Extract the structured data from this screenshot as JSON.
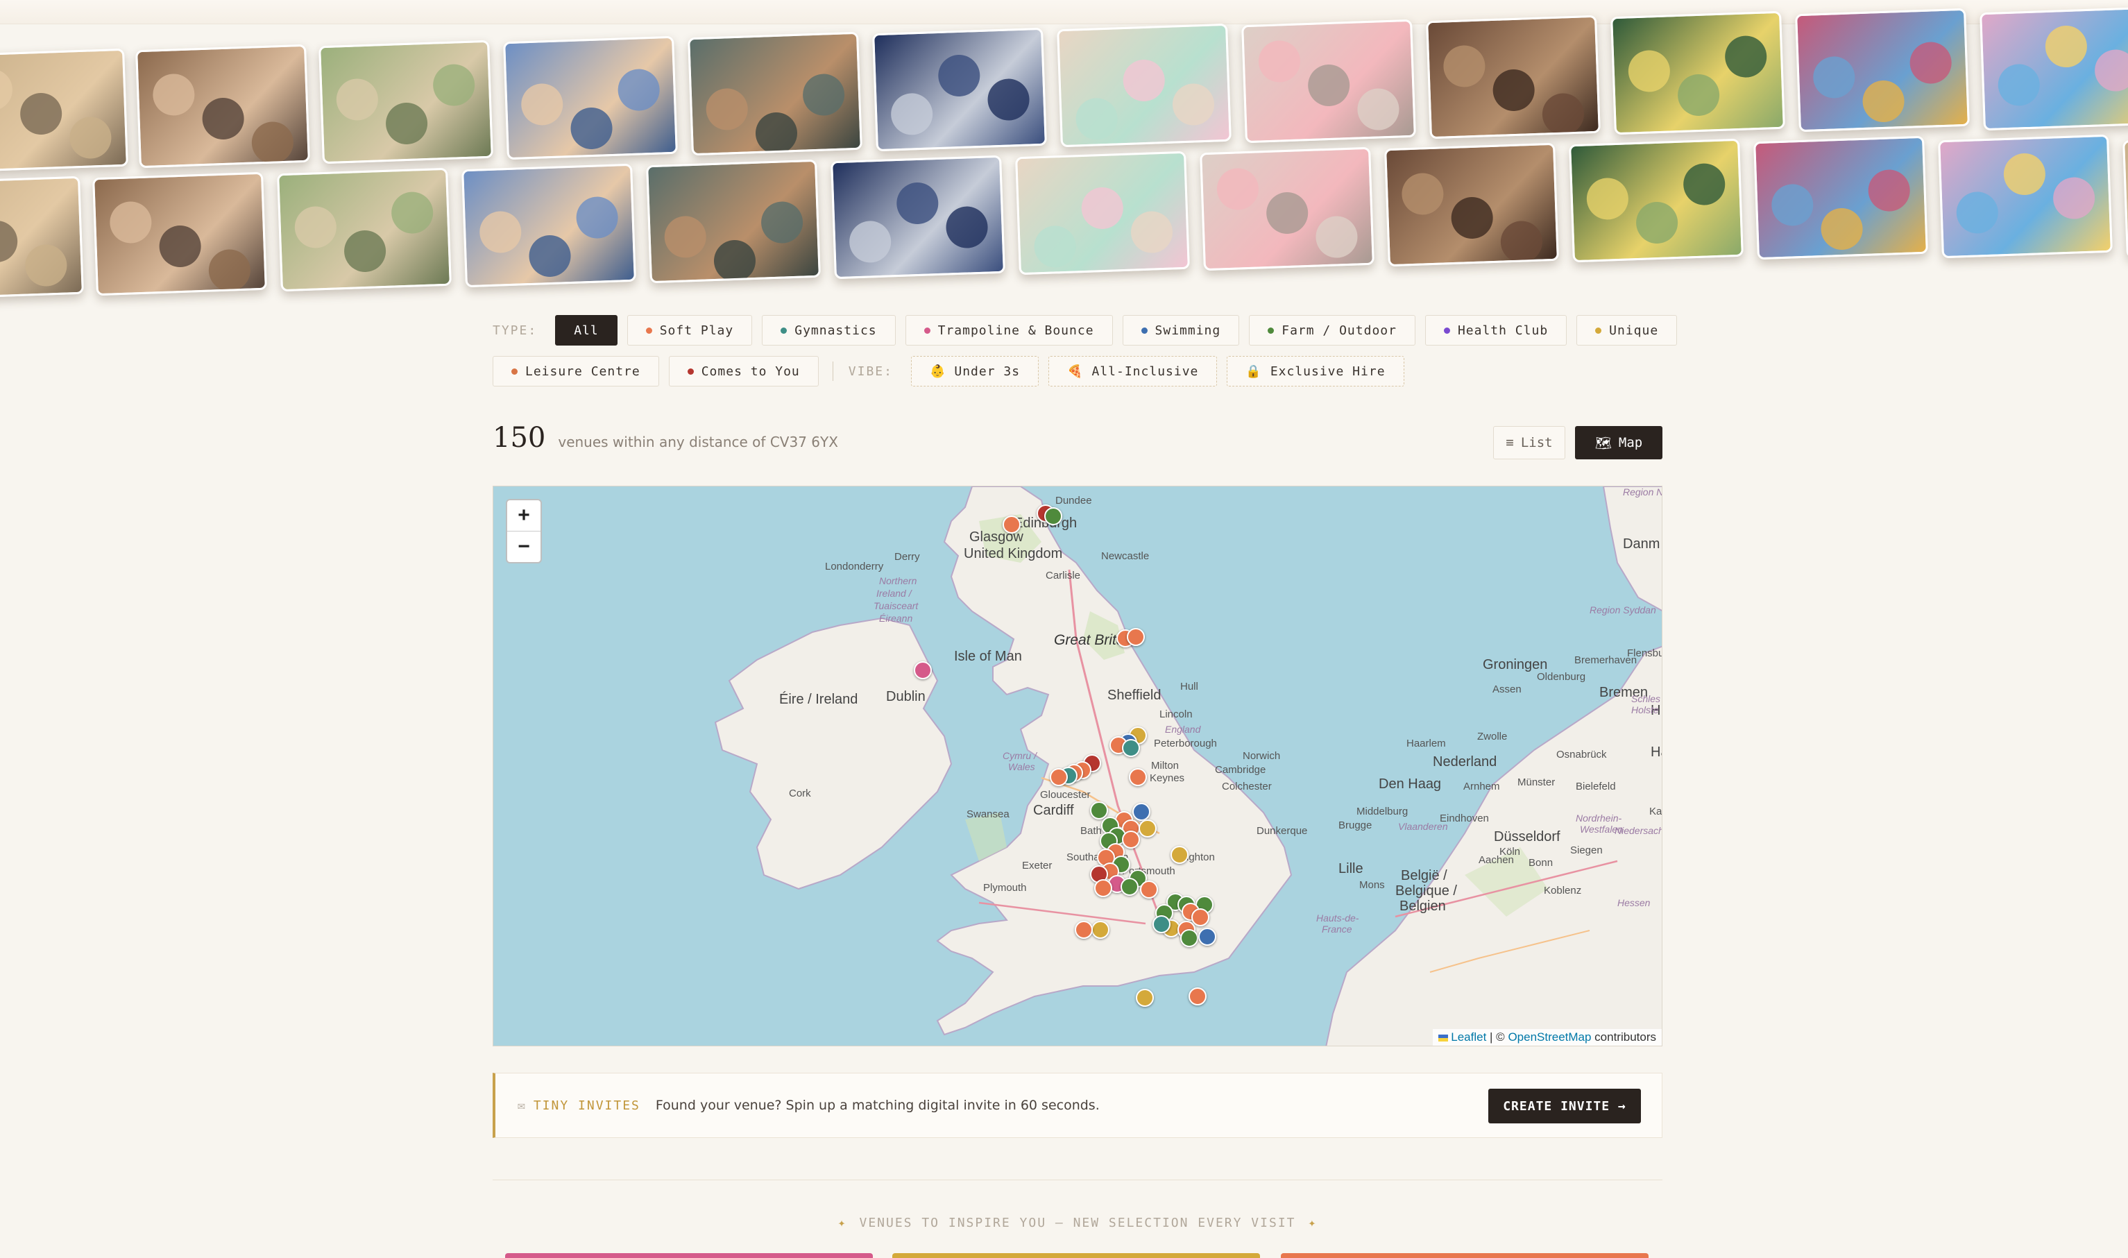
{
  "filters": {
    "type_label": "TYPE:",
    "vibe_label": "VIBE:",
    "types": [
      {
        "label": "All",
        "color": "",
        "active": true
      },
      {
        "label": "Soft Play",
        "color": "#e8774d"
      },
      {
        "label": "Gymnastics",
        "color": "#3e8e86"
      },
      {
        "label": "Trampoline & Bounce",
        "color": "#d55a8a"
      },
      {
        "label": "Swimming",
        "color": "#3e6fb0"
      },
      {
        "label": "Farm / Outdoor",
        "color": "#4f8a3c"
      },
      {
        "label": "Health Club",
        "color": "#7a4ad0"
      },
      {
        "label": "Unique",
        "color": "#d4a93a"
      },
      {
        "label": "Leisure Centre",
        "color": "#d87545"
      },
      {
        "label": "Comes to You",
        "color": "#b5362f"
      }
    ],
    "vibes": [
      {
        "label": "Under 3s",
        "icon": "baby-face-icon",
        "glyph": "👶"
      },
      {
        "label": "All-Inclusive",
        "icon": "pizza-icon",
        "glyph": "🍕"
      },
      {
        "label": "Exclusive Hire",
        "icon": "lock-icon",
        "glyph": "🔒"
      }
    ]
  },
  "results": {
    "count": "150",
    "summary": "venues within any distance of CV37 6YX",
    "list_label": "List",
    "map_label": "Map",
    "list_icon": "≡",
    "map_icon": "🗺"
  },
  "map": {
    "zoom_in": "+",
    "zoom_out": "−",
    "attribution_leaflet": "Leaflet",
    "attribution_sep": " | © ",
    "attribution_osm": "OpenStreetMap",
    "attribution_tail": " contributors",
    "labels": {
      "dundee": "Dundee",
      "edinburgh": "Edinburgh",
      "glasgow": "Glasgow",
      "uk": "United Kingdom",
      "derry": "Derry",
      "londonderry": "Londonderry",
      "ni1": "Northern",
      "ni2": "Ireland /",
      "ni3": "Tuaisceart",
      "ni4": "Éireann",
      "carlisle": "Carlisle",
      "newcastle": "Newcastle",
      "gb": "Great Britain",
      "isle_of_man": "Isle of Man",
      "ireland": "Éire / Ireland",
      "dublin": "Dublin",
      "cork": "Cork",
      "sheffield": "Sheffield",
      "hull": "Hull",
      "lincoln": "Lincoln",
      "england": "England",
      "peterborough": "Peterborough",
      "norwich": "Norwich",
      "cymru": "Cymru /",
      "wales": "Wales",
      "cambridge": "Cambridge",
      "colchester": "Colchester",
      "milton": "Milton",
      "keynes": "Keynes",
      "gloucester": "Gloucester",
      "swansea": "Swansea",
      "cardiff": "Cardiff",
      "bath": "Bath",
      "southampton": "Southampton",
      "portsmouth": "Portsmouth",
      "brighton": "Brighton",
      "exeter": "Exeter",
      "plymouth": "Plymouth",
      "dunkerque": "Dunkerque",
      "brugge": "Brugge",
      "lille": "Lille",
      "mons": "Mons",
      "belgie1": "België /",
      "belgie2": "Belgique /",
      "belgie3": "Belgien",
      "denhaag": "Den Haag",
      "nederland": "Nederland",
      "haarlem": "Haarlem",
      "groningen": "Groningen",
      "assen": "Assen",
      "zwolle": "Zwolle",
      "arnhem": "Arnhem",
      "munster": "Münster",
      "bielefeld": "Bielefeld",
      "osnabruck": "Osnabrück",
      "oldenburg": "Oldenburg",
      "bremen": "Bremen",
      "bremerhaven": "Bremerhaven",
      "dusseldorf": "Düsseldorf",
      "koln": "Köln",
      "bonn": "Bonn",
      "siegen": "Siegen",
      "koblenz": "Koblenz",
      "aachen": "Aachen",
      "eindhoven": "Eindhoven",
      "middelburg": "Middelburg",
      "danmark": "Danm",
      "flensburg": "Flensbu",
      "nrw": "Nordrhein-",
      "westfalen": "Westfalen",
      "hamburg_h": "H",
      "hannover": "Han",
      "kassel": "Kass",
      "vlaanderen": "Vlaanderen",
      "hauts": "Hauts-de-",
      "france": "France",
      "schleswig": "Schles",
      "holstein": "Holste",
      "syddanmark": "Region Syddan",
      "regionN": "Region N",
      "niedersachsen": "Niedersachsen",
      "hessen": "Hessen"
    }
  },
  "invite": {
    "icon": "envelope-icon",
    "glyph": "✉",
    "tag": "TINY INVITES",
    "message": "Found your venue? Spin up a matching digital invite in 60 seconds.",
    "cta": "CREATE INVITE →"
  },
  "inspire": {
    "text": "VENUES TO INSPIRE YOU — NEW SELECTION EVERY VISIT",
    "spark": "✦"
  },
  "colors": {
    "accent_gold": "#c8a14c",
    "dark": "#2a231f",
    "pin_soft_play": "#e8774d",
    "pin_gymnastics": "#3e8e86",
    "pin_trampoline": "#d55a8a",
    "pin_swimming": "#3e6fb0",
    "pin_farm": "#4f8a3c",
    "pin_unique": "#d4a93a",
    "pin_comes_to_you": "#b5362f"
  }
}
